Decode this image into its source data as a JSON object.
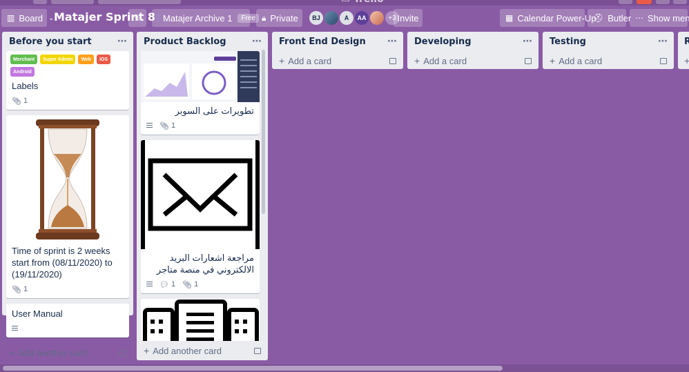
{
  "header": {
    "board_view_label": "Board",
    "board_title": "Matajer Sprint 8",
    "workspace_name": "Matajer Archive 1",
    "workspace_plan": "Free",
    "visibility": "Private",
    "members": [
      "BJ",
      "",
      "A",
      "AA",
      ""
    ],
    "members_more": "+3",
    "invite_label": "Invite",
    "calendar_label": "Calendar Power-Up",
    "butler_label": "Butler",
    "show_menu_label": "Show menu"
  },
  "add_card_label": "Add a card",
  "add_another_card_label": "Add another card",
  "lists": [
    {
      "title": "Before you start",
      "label_chips": [
        {
          "text": "Merchant",
          "color": "#61bd4f"
        },
        {
          "text": "Super Admin",
          "color": "#f2d600"
        },
        {
          "text": "Web",
          "color": "#ff9f1a"
        },
        {
          "text": "iOS",
          "color": "#eb5a46"
        },
        {
          "text": "Android",
          "color": "#c377e0"
        }
      ],
      "cards": [
        {
          "title": "Labels",
          "attachments": "1"
        },
        {
          "title": "Time of sprint is 2 weeks start from (08/11/2020) to (19/11/2020)",
          "attachments": "1"
        },
        {
          "title": "User Manual"
        }
      ]
    },
    {
      "title": "Product Backlog",
      "cards": [
        {
          "title": "تطويرات على السوبر",
          "attachments": "1"
        },
        {
          "title": "مراجعة اشعارات البريد الالكتروني في منصة متاجر",
          "comments": "1",
          "attachments": "1"
        }
      ]
    },
    {
      "title": "Front End Design"
    },
    {
      "title": "Developing"
    },
    {
      "title": "Testing"
    },
    {
      "title": "R"
    }
  ],
  "colors": {
    "board_bg": "#8a5ba5",
    "list_bg": "#ebecf0"
  }
}
